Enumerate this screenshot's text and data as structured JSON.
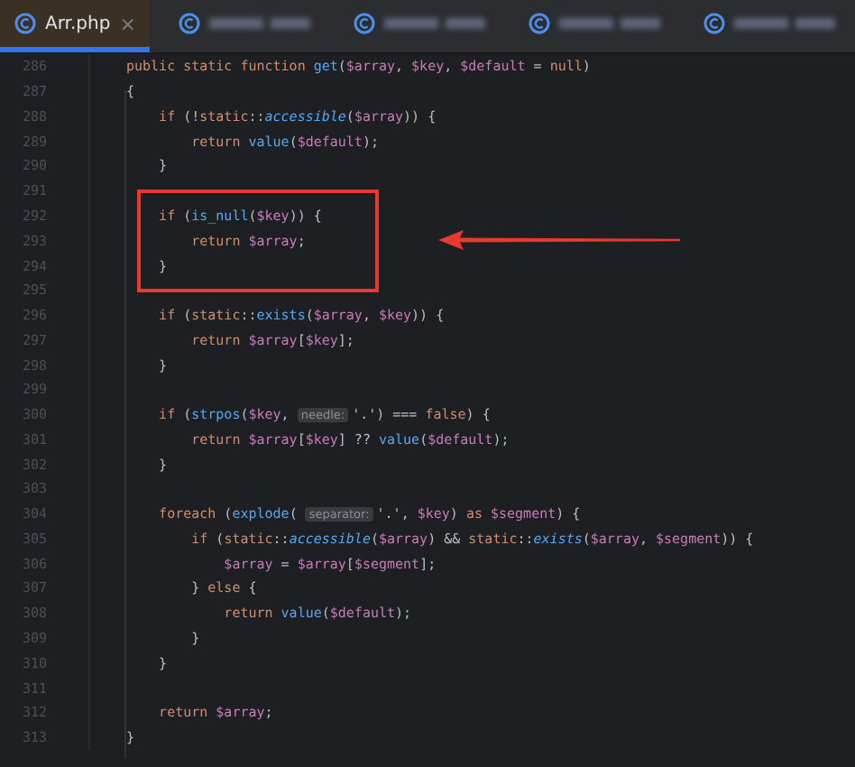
{
  "tabs": [
    {
      "label": "Arr.php",
      "selected": true,
      "close": "×"
    },
    {
      "selected": false
    },
    {
      "selected": false
    },
    {
      "selected": false
    },
    {
      "selected": false
    }
  ],
  "lines": [
    {
      "number": "286",
      "tokens": [
        {
          "text": "public static function ",
          "kind": "keyword"
        },
        {
          "text": "get",
          "kind": "function"
        },
        {
          "text": "(",
          "kind": "plain"
        },
        {
          "text": "$array",
          "kind": "variable"
        },
        {
          "text": ", ",
          "kind": "plain"
        },
        {
          "text": "$key",
          "kind": "variable"
        },
        {
          "text": ", ",
          "kind": "plain"
        },
        {
          "text": "$default",
          "kind": "variable"
        },
        {
          "text": " = ",
          "kind": "plain"
        },
        {
          "text": "null",
          "kind": "keyword"
        },
        {
          "text": ")",
          "kind": "plain"
        }
      ]
    },
    {
      "number": "287",
      "tokens": [
        {
          "text": "{",
          "kind": "plain"
        }
      ]
    },
    {
      "number": "288",
      "tokens": [
        {
          "text": "    if",
          "kind": "keyword"
        },
        {
          "text": " (!",
          "kind": "plain"
        },
        {
          "text": "static",
          "kind": "keyword"
        },
        {
          "text": "::",
          "kind": "plain"
        },
        {
          "text": "accessible",
          "kind": "static-call"
        },
        {
          "text": "(",
          "kind": "plain"
        },
        {
          "text": "$array",
          "kind": "variable"
        },
        {
          "text": ")) {",
          "kind": "plain"
        }
      ]
    },
    {
      "number": "289",
      "tokens": [
        {
          "text": "        return ",
          "kind": "keyword"
        },
        {
          "text": "value",
          "kind": "function"
        },
        {
          "text": "(",
          "kind": "plain"
        },
        {
          "text": "$default",
          "kind": "variable"
        },
        {
          "text": ");",
          "kind": "plain"
        }
      ]
    },
    {
      "number": "290",
      "tokens": [
        {
          "text": "    }",
          "kind": "plain"
        }
      ]
    },
    {
      "number": "291"
    },
    {
      "number": "292",
      "boxed": true,
      "tokens": [
        {
          "text": "    if",
          "kind": "keyword"
        },
        {
          "text": " (",
          "kind": "plain"
        },
        {
          "text": "is_null",
          "kind": "function"
        },
        {
          "text": "(",
          "kind": "plain"
        },
        {
          "text": "$key",
          "kind": "variable"
        },
        {
          "text": ")) {",
          "kind": "plain"
        }
      ]
    },
    {
      "number": "293",
      "boxed": true,
      "tokens": [
        {
          "text": "        return ",
          "kind": "keyword"
        },
        {
          "text": "$array",
          "kind": "variable"
        },
        {
          "text": ";",
          "kind": "plain"
        }
      ]
    },
    {
      "number": "294",
      "boxed": true,
      "tokens": [
        {
          "text": "    }",
          "kind": "plain"
        }
      ]
    },
    {
      "number": "295"
    },
    {
      "number": "296",
      "tokens": [
        {
          "text": "    if",
          "kind": "keyword"
        },
        {
          "text": " (",
          "kind": "plain"
        },
        {
          "text": "static",
          "kind": "keyword"
        },
        {
          "text": "::",
          "kind": "plain"
        },
        {
          "text": "exists",
          "kind": "function"
        },
        {
          "text": "(",
          "kind": "plain"
        },
        {
          "text": "$array",
          "kind": "variable"
        },
        {
          "text": ", ",
          "kind": "plain"
        },
        {
          "text": "$key",
          "kind": "variable"
        },
        {
          "text": ")) {",
          "kind": "plain"
        }
      ]
    },
    {
      "number": "297",
      "tokens": [
        {
          "text": "        return ",
          "kind": "keyword"
        },
        {
          "text": "$array",
          "kind": "variable"
        },
        {
          "text": "[",
          "kind": "plain"
        },
        {
          "text": "$key",
          "kind": "variable"
        },
        {
          "text": "];",
          "kind": "plain"
        }
      ]
    },
    {
      "number": "298",
      "tokens": [
        {
          "text": "    }",
          "kind": "plain"
        }
      ]
    },
    {
      "number": "299"
    },
    {
      "number": "300",
      "tokens": [
        {
          "text": "    if",
          "kind": "keyword"
        },
        {
          "text": " (",
          "kind": "plain"
        },
        {
          "text": "strpos",
          "kind": "function"
        },
        {
          "text": "(",
          "kind": "plain"
        },
        {
          "text": "$key",
          "kind": "variable"
        },
        {
          "text": ", ",
          "kind": "plain"
        },
        {
          "text": "needle:",
          "kind": "hint"
        },
        {
          "text": "'.') === ",
          "kind": "plain"
        },
        {
          "text": "false",
          "kind": "keyword"
        },
        {
          "text": ") {",
          "kind": "plain"
        }
      ]
    },
    {
      "number": "301",
      "tokens": [
        {
          "text": "        return ",
          "kind": "keyword"
        },
        {
          "text": "$array",
          "kind": "variable"
        },
        {
          "text": "[",
          "kind": "plain"
        },
        {
          "text": "$key",
          "kind": "variable"
        },
        {
          "text": "] ?? ",
          "kind": "plain"
        },
        {
          "text": "value",
          "kind": "function"
        },
        {
          "text": "(",
          "kind": "plain"
        },
        {
          "text": "$default",
          "kind": "variable"
        },
        {
          "text": ");",
          "kind": "plain"
        }
      ]
    },
    {
      "number": "302",
      "tokens": [
        {
          "text": "    }",
          "kind": "plain"
        }
      ]
    },
    {
      "number": "303"
    },
    {
      "number": "304",
      "tokens": [
        {
          "text": "    foreach",
          "kind": "keyword"
        },
        {
          "text": " (",
          "kind": "plain"
        },
        {
          "text": "explode",
          "kind": "function"
        },
        {
          "text": "( ",
          "kind": "plain"
        },
        {
          "text": "separator:",
          "kind": "hint"
        },
        {
          "text": "'.', ",
          "kind": "plain"
        },
        {
          "text": "$key",
          "kind": "variable"
        },
        {
          "text": ") ",
          "kind": "plain"
        },
        {
          "text": "as ",
          "kind": "keyword"
        },
        {
          "text": "$segment",
          "kind": "variable"
        },
        {
          "text": ") {",
          "kind": "plain"
        }
      ]
    },
    {
      "number": "305",
      "tokens": [
        {
          "text": "        if",
          "kind": "keyword"
        },
        {
          "text": " (",
          "kind": "plain"
        },
        {
          "text": "static",
          "kind": "keyword"
        },
        {
          "text": "::",
          "kind": "plain"
        },
        {
          "text": "accessible",
          "kind": "static-call"
        },
        {
          "text": "(",
          "kind": "plain"
        },
        {
          "text": "$array",
          "kind": "variable"
        },
        {
          "text": ") && ",
          "kind": "plain"
        },
        {
          "text": "static",
          "kind": "keyword"
        },
        {
          "text": "::",
          "kind": "plain"
        },
        {
          "text": "exists",
          "kind": "static-call"
        },
        {
          "text": "(",
          "kind": "plain"
        },
        {
          "text": "$array",
          "kind": "variable"
        },
        {
          "text": ", ",
          "kind": "plain"
        },
        {
          "text": "$segment",
          "kind": "variable"
        },
        {
          "text": ")) {",
          "kind": "plain"
        }
      ]
    },
    {
      "number": "306",
      "tokens": [
        {
          "text": "            $array",
          "kind": "variable"
        },
        {
          "text": " = ",
          "kind": "plain"
        },
        {
          "text": "$array",
          "kind": "variable"
        },
        {
          "text": "[",
          "kind": "plain"
        },
        {
          "text": "$segment",
          "kind": "variable"
        },
        {
          "text": "];",
          "kind": "plain"
        }
      ]
    },
    {
      "number": "307",
      "tokens": [
        {
          "text": "        } ",
          "kind": "plain"
        },
        {
          "text": "else",
          "kind": "keyword"
        },
        {
          "text": " {",
          "kind": "plain"
        }
      ]
    },
    {
      "number": "308",
      "tokens": [
        {
          "text": "            return ",
          "kind": "keyword"
        },
        {
          "text": "value",
          "kind": "function"
        },
        {
          "text": "(",
          "kind": "plain"
        },
        {
          "text": "$default",
          "kind": "variable"
        },
        {
          "text": ");",
          "kind": "plain"
        }
      ]
    },
    {
      "number": "309",
      "tokens": [
        {
          "text": "        }",
          "kind": "plain"
        }
      ]
    },
    {
      "number": "310",
      "tokens": [
        {
          "text": "    }",
          "kind": "plain"
        }
      ]
    },
    {
      "number": "311"
    },
    {
      "number": "312",
      "tokens": [
        {
          "text": "    return ",
          "kind": "keyword"
        },
        {
          "text": "$array",
          "kind": "variable"
        },
        {
          "text": ";",
          "kind": "plain"
        }
      ]
    },
    {
      "number": "313",
      "tokens": [
        {
          "text": "}",
          "kind": "plain"
        }
      ]
    }
  ]
}
